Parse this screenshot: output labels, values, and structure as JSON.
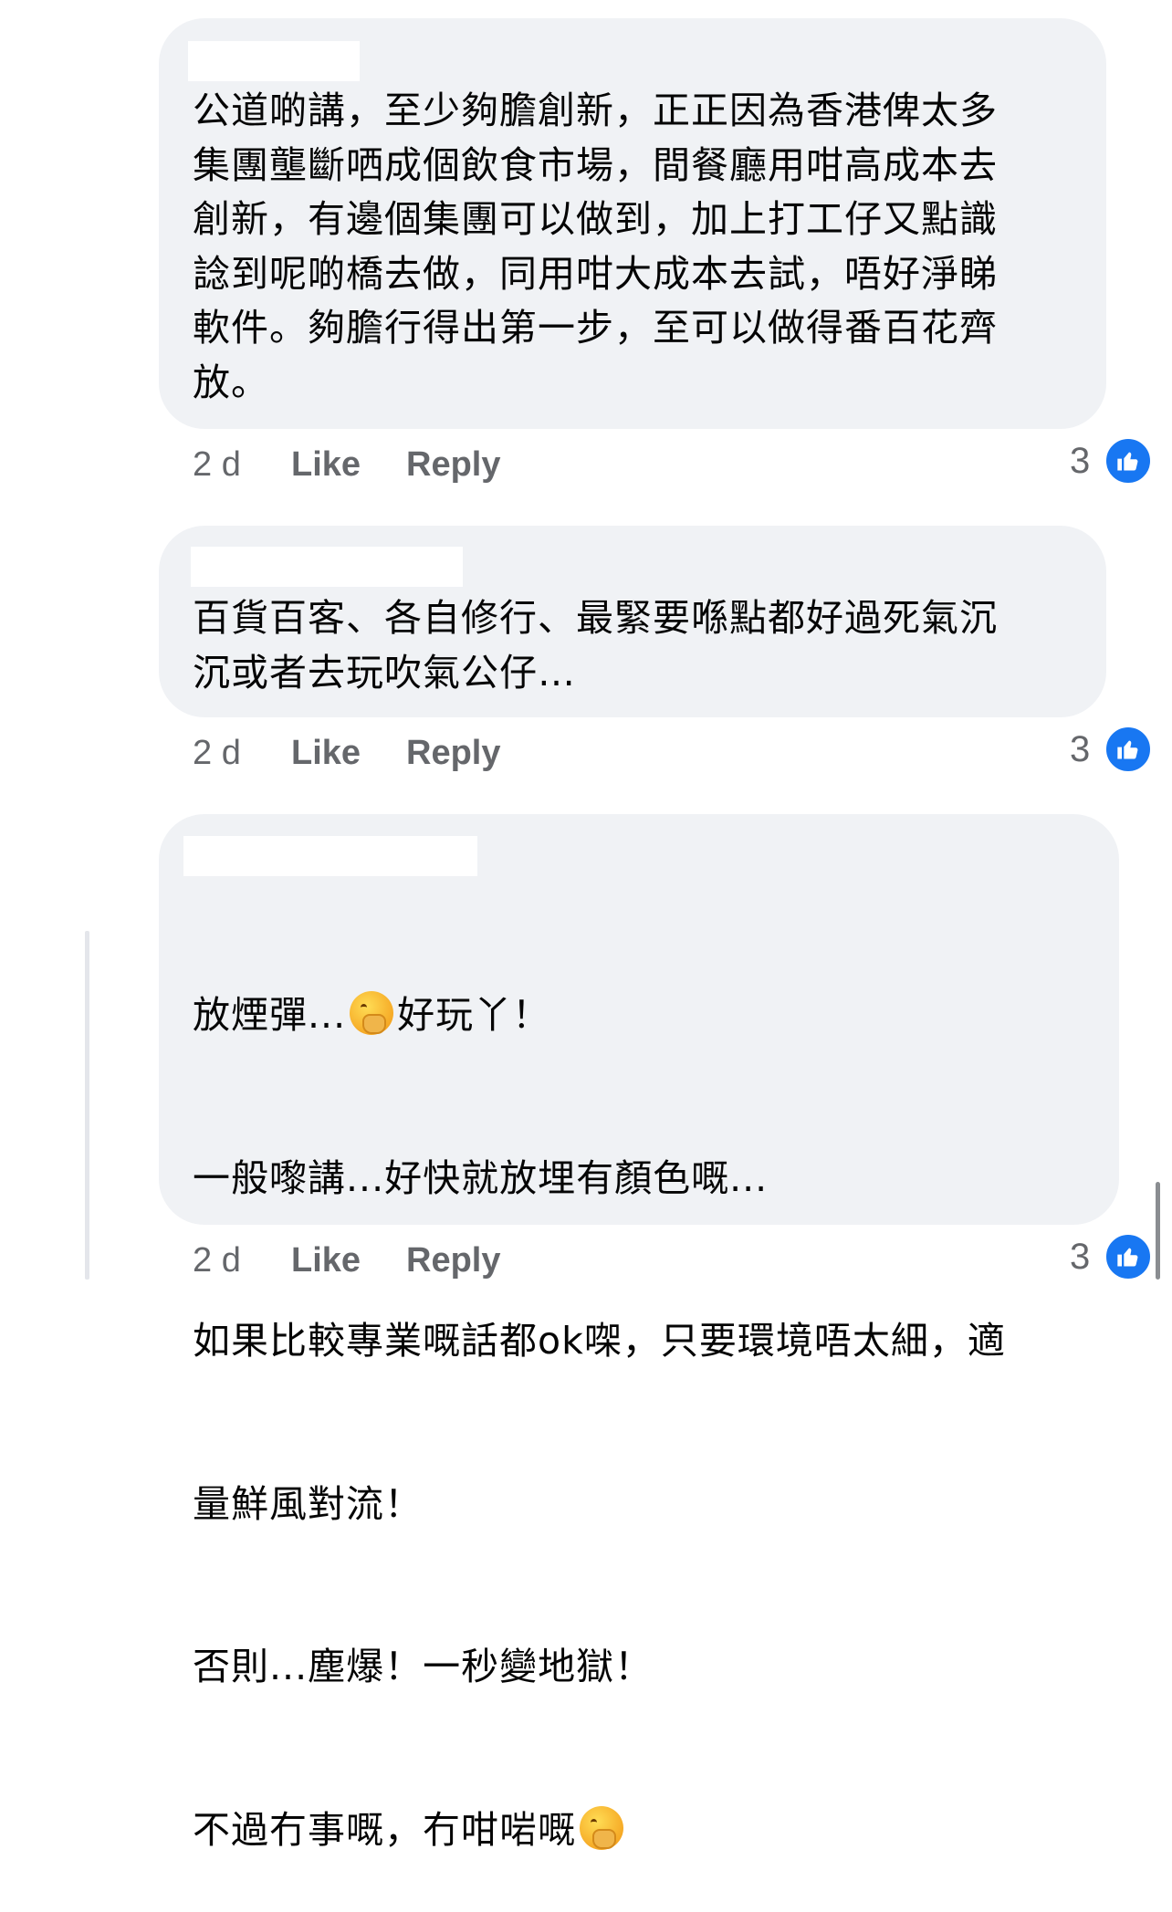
{
  "comments": [
    {
      "text": "公道啲講，至少夠膽創新，正正因為香港俾太多\n集團壟斷哂成個飲食市場，間餐廳用咁高成本去\n創新，有邊個集團可以做到，加上打工仔又點識\n諗到呢啲橋去做，同用咁大成本去試，唔好淨睇\n軟件。夠膽行得出第一步，至可以做得番百花齊\n放。",
      "time": "2 d",
      "like_label": "Like",
      "reply_label": "Reply",
      "reaction_count": "3"
    },
    {
      "text": "百貨百客、各自修行、最緊要喺點都好過死氣沉\n沉或者去玩吹氣公仔…",
      "time": "2 d",
      "like_label": "Like",
      "reply_label": "Reply",
      "reaction_count": "3"
    },
    {
      "lines": [
        {
          "before": "放煙彈...",
          "emoji": "hand-over-mouth-emoji",
          "after": "好玩丫！"
        },
        {
          "before": "一般嚟講...好快就放埋有顏色嘅..."
        },
        {
          "before": "如果比較專業嘅話都ok㗎，只要環境唔太細，適"
        },
        {
          "before": "量鮮風對流！"
        },
        {
          "before": "否則...塵爆！一秒變地獄！"
        },
        {
          "before": "不過冇事嘅，冇咁啱嘅",
          "emoji": "hand-over-mouth-emoji"
        }
      ],
      "time": "2 d",
      "like_label": "Like",
      "reply_label": "Reply",
      "reaction_count": "3"
    }
  ],
  "colors": {
    "bubble": "#f0f2f5",
    "meta_text": "#65676b",
    "like_badge": "#1877f2"
  }
}
